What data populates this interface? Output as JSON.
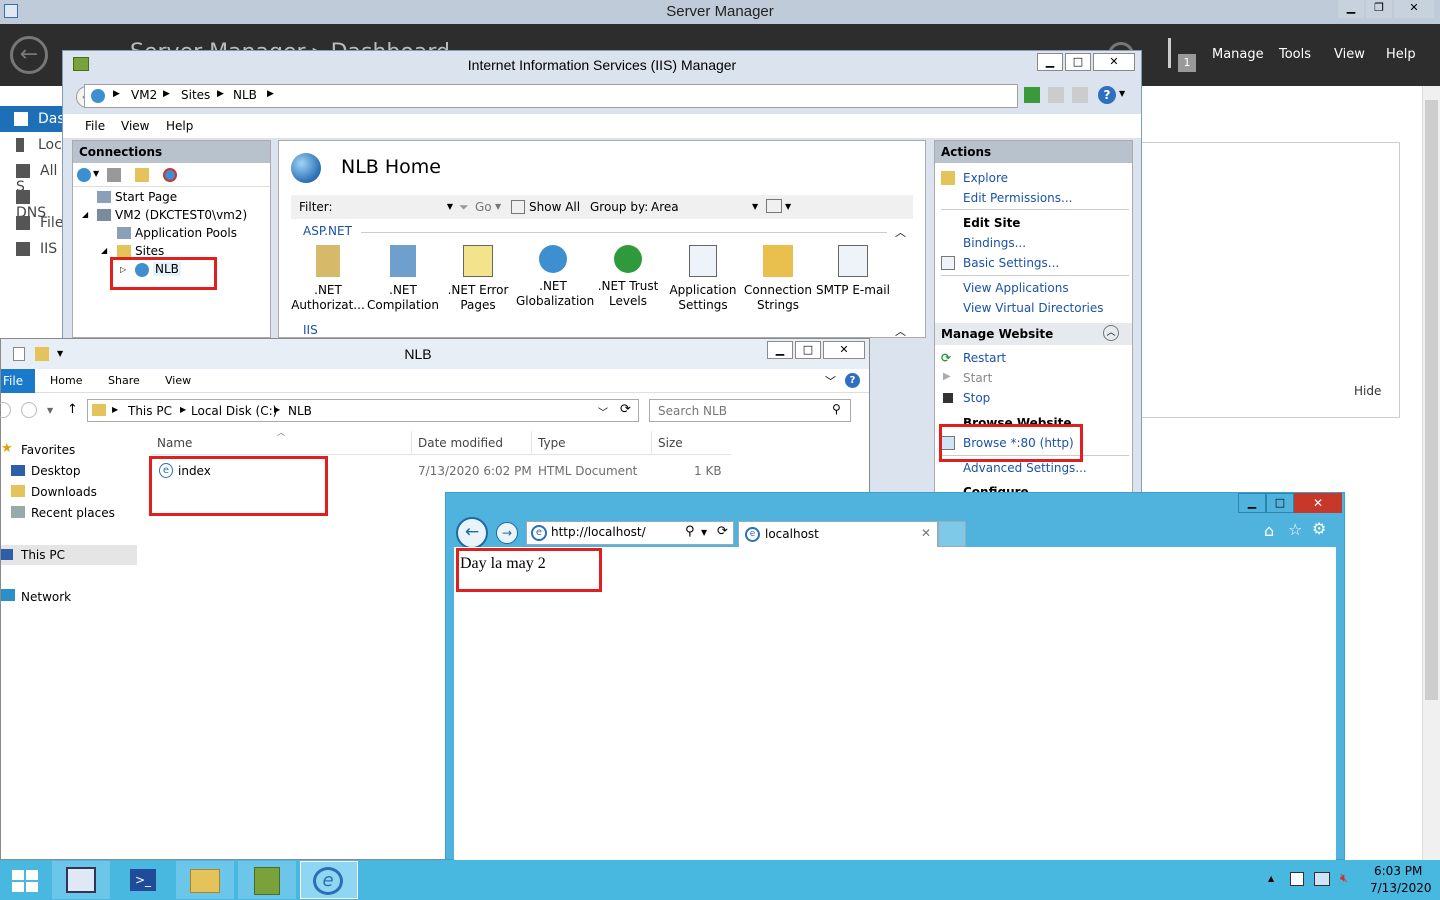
{
  "server_manager": {
    "title": "Server Manager",
    "header_text": "Server Manager ▸ Dashboard",
    "menu": [
      "Manage",
      "Tools",
      "View",
      "Help"
    ],
    "flag_count": "1",
    "side_items": [
      "Das",
      "Loc",
      "All S",
      "DNS",
      "File",
      "IIS"
    ],
    "right_hide": "Hide"
  },
  "iis": {
    "title": "Internet Information Services (IIS) Manager",
    "breadcrumb": [
      "VM2",
      "Sites",
      "NLB"
    ],
    "menu": [
      "File",
      "View",
      "Help"
    ],
    "connections_header": "Connections",
    "tree": [
      "Start Page",
      "VM2 (DKCTEST0\\vm2)",
      "Application Pools",
      "Sites",
      "NLB"
    ],
    "home_title": "NLB Home",
    "filter_label": "Filter:",
    "go_label": "Go",
    "show_all_label": "Show All",
    "group_by_label": "Group by:",
    "group_by_value": "Area",
    "section_aspnet": "ASP.NET",
    "section_iis": "IIS",
    "features": [
      {
        "line1": ".NET",
        "line2": "Authorizat..."
      },
      {
        "line1": ".NET",
        "line2": "Compilation"
      },
      {
        "line1": ".NET Error",
        "line2": "Pages"
      },
      {
        "line1": ".NET",
        "line2": "Globalization"
      },
      {
        "line1": ".NET Trust",
        "line2": "Levels"
      },
      {
        "line1": "Application",
        "line2": "Settings"
      },
      {
        "line1": "Connection",
        "line2": "Strings"
      },
      {
        "line1": "SMTP E-mail",
        "line2": ""
      }
    ],
    "actions_header": "Actions",
    "actions": {
      "explore": "Explore",
      "edit_permissions": "Edit Permissions...",
      "edit_site": "Edit Site",
      "bindings": "Bindings...",
      "basic_settings": "Basic Settings...",
      "view_applications": "View Applications",
      "view_virtual_dirs": "View Virtual Directories",
      "manage_website": "Manage Website",
      "restart": "Restart",
      "start": "Start",
      "stop": "Stop",
      "browse_website": "Browse Website",
      "browse_80": "Browse *:80 (http)",
      "advanced_settings": "Advanced Settings...",
      "configure": "Configure"
    }
  },
  "explorer": {
    "title": "NLB",
    "ribbon_tabs": [
      "File",
      "Home",
      "Share",
      "View"
    ],
    "path": [
      "This PC",
      "Local Disk (C:)",
      "NLB"
    ],
    "search_placeholder": "Search NLB",
    "columns": [
      "Name",
      "Date modified",
      "Type",
      "Size"
    ],
    "files": [
      {
        "name": "index",
        "date": "7/13/2020 6:02 PM",
        "type": "HTML Document",
        "size": "1 KB"
      }
    ],
    "nav": {
      "favorites": "Favorites",
      "desktop": "Desktop",
      "downloads": "Downloads",
      "recent": "Recent places",
      "this_pc": "This PC",
      "network": "Network"
    }
  },
  "browser": {
    "url": "http://localhost/",
    "tab_title": "localhost",
    "page_text": "Day la may 2"
  },
  "taskbar": {
    "time": "6:03 PM",
    "date": "7/13/2020"
  },
  "colors": {
    "highlight_red": "#e0201e",
    "taskbar": "#48b8e0",
    "link": "#1a52a8"
  }
}
